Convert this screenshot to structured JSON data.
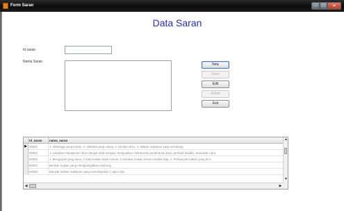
{
  "window": {
    "title": "Form Saran",
    "minimize_glyph": "–",
    "maximize_glyph": "□",
    "close_glyph": "✕"
  },
  "form": {
    "title": "Data Saran",
    "id_label": "Id saran",
    "nama_label": "Nama Saran",
    "id_value": "",
    "nama_value": ""
  },
  "buttons": {
    "new": "New",
    "save": "Save",
    "edit": "Edit",
    "delete": "delete",
    "exit": "Exit"
  },
  "grid": {
    "columns": [
      "id_saran",
      "nama_saran"
    ],
    "current_row_marker": "▶",
    "rows": [
      {
        "id": "00001",
        "nama": "1. Olahraga yang teratur, 2. Istirahat yang cukup, 3. Hindari stres, 4. Makan makanan yang seimbang"
      },
      {
        "id": "00002",
        "nama": "1. Lakukan manajemen stres dengan baik dengan menguatkan mekanisme pertahanan jiwa ( perbaiki ibadah, sesuaikan cara"
      },
      {
        "id": "00003",
        "nama": "1. Menguyah yang lama, 2.Saat makan tidak minum, 3.Sehabis makan minum sedikit saja, 4. Perbanyak makan yang di m"
      },
      {
        "id": "00004",
        "nama": "Berikan makan yang menghangatkan lambung"
      },
      {
        "id": "00005",
        "nama": "Banyak makan makanan yang mendinginkan ( sayur dan"
      }
    ],
    "scroll_up": "▲",
    "scroll_down": "▼",
    "scroll_left": "◀",
    "scroll_right": "▶"
  },
  "colors": {
    "title_color": "#2233a0",
    "titlebar_color": "#111111"
  }
}
